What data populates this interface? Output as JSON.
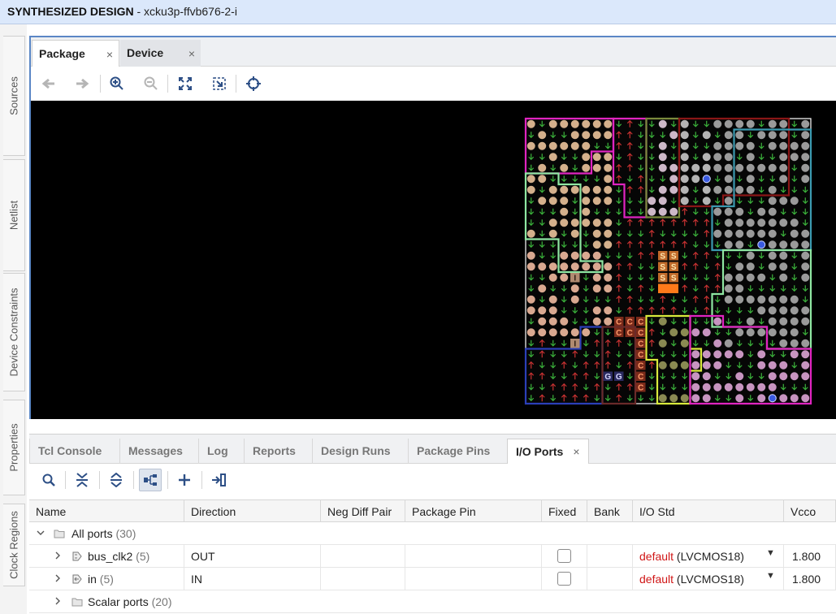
{
  "title": {
    "bold": "SYNTHESIZED DESIGN",
    "rest": " - xcku3p-ffvb676-2-i"
  },
  "side_tabs": [
    "Sources",
    "Netlist",
    "Device Constraints",
    "Properties",
    "Clock Regions"
  ],
  "package_window": {
    "tabs": [
      {
        "label": "Package",
        "active": true
      },
      {
        "label": "Device",
        "active": false
      }
    ],
    "close_glyph": "×",
    "toolbar": [
      "back-arrow-icon",
      "forward-arrow-icon",
      "zoom-in-icon",
      "zoom-out-icon",
      "fit-view-icon",
      "zoom-to-selection-icon",
      "crosshair-icon"
    ]
  },
  "package_markers": {
    "s": "S",
    "c": "C",
    "g": "G",
    "i": "I"
  },
  "bottom_panel": {
    "tabs": [
      {
        "label": "Tcl Console",
        "active": false
      },
      {
        "label": "Messages",
        "active": false
      },
      {
        "label": "Log",
        "active": false
      },
      {
        "label": "Reports",
        "active": false
      },
      {
        "label": "Design Runs",
        "active": false
      },
      {
        "label": "Package Pins",
        "active": false
      },
      {
        "label": "I/O Ports",
        "active": true
      }
    ],
    "toolbar": [
      "search-icon",
      "collapse-all-icon",
      "expand-all-icon",
      "group-by-interface-icon",
      "add-icon",
      "auto-assign-icon"
    ]
  },
  "io_table": {
    "columns": [
      "Name",
      "Direction",
      "Neg Diff Pair",
      "Package Pin",
      "Fixed",
      "Bank",
      "I/O Std",
      "Vcco"
    ],
    "rows": [
      {
        "name": "All ports",
        "count": "(30)",
        "expanded": true,
        "indent": 0,
        "icon": "folder-icon"
      },
      {
        "name": "bus_clk2",
        "count": "(5)",
        "direction": "OUT",
        "fixed": false,
        "io_std_default": "default",
        "io_std": " (LVCMOS18)",
        "vcco": "1.800",
        "indent": 1,
        "icon": "output-port-icon"
      },
      {
        "name": "in",
        "count": "(5)",
        "direction": "IN",
        "fixed": false,
        "io_std_default": "default",
        "io_std": " (LVCMOS18)",
        "vcco": "1.800",
        "indent": 1,
        "icon": "input-port-icon"
      },
      {
        "name": "Scalar ports",
        "count": "(20)",
        "indent": 1,
        "icon": "folder-icon"
      }
    ]
  },
  "colors": {
    "accent_blue": "#5a86c5",
    "default_red": "#d01616",
    "bank_magenta": "#e024c0",
    "bank_green": "#8fe7a2",
    "bank_blue": "#2b3fb8",
    "bank_teal": "#3b9ab0",
    "bank_yellow": "#d9ea3c",
    "bank_darkred": "#8a1616"
  }
}
